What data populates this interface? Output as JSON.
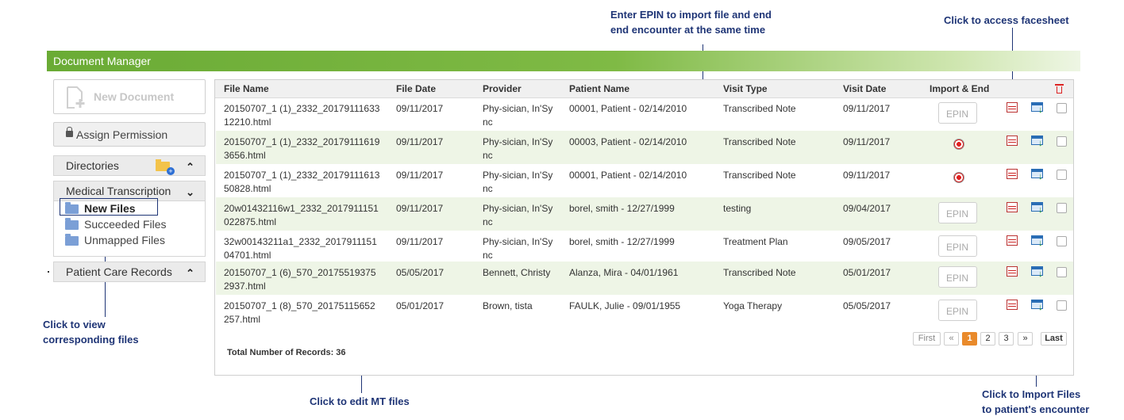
{
  "callouts": {
    "epin": "Enter EPIN to import file and end\nend encounter at the same time",
    "facesheet": "Click to access facesheet",
    "view_files": "Click to view\ncorresponding files",
    "edit_mt": "Click to edit MT files",
    "import_files": "Click to Import Files\nto patient's encounter"
  },
  "header": {
    "title": "Document Manager"
  },
  "sidebar": {
    "new_document": "New Document",
    "assign_permission": "Assign Permission",
    "directories": "Directories",
    "medical_transcription": "Medical Transcription",
    "tree": [
      "New Files",
      "Succeeded Files",
      "Unmapped Files"
    ],
    "patient_care_records": "Patient Care Records"
  },
  "grid": {
    "columns": [
      "File Name",
      "File Date",
      "Provider",
      "Patient Name",
      "Visit Type",
      "Visit Date",
      "Import & End"
    ],
    "rows": [
      {
        "file": "20150707_1 (1)_2332_20179111633\n12210.html",
        "date": "09/11/2017",
        "provider": "Phy-sician, In'Sy\nnc",
        "patient": "00001, Patient - 02/14/2010",
        "visit_type": "Transcribed Note",
        "visit_date": "09/11/2017",
        "action": "epin"
      },
      {
        "file": "20150707_1 (1)_2332_20179111619\n3656.html",
        "date": "09/11/2017",
        "provider": "Phy-sician, In'Sy\nnc",
        "patient": "00003, Patient - 02/14/2010",
        "visit_type": "Transcribed Note",
        "visit_date": "09/11/2017",
        "action": "end"
      },
      {
        "file": "20150707_1 (1)_2332_20179111613\n50828.html",
        "date": "09/11/2017",
        "provider": "Phy-sician, In'Sy\nnc",
        "patient": "00001, Patient - 02/14/2010",
        "visit_type": "Transcribed Note",
        "visit_date": "09/11/2017",
        "action": "end"
      },
      {
        "file": "20w01432116w1_2332_2017911151\n022875.html",
        "date": "09/11/2017",
        "provider": "Phy-sician, In'Sy\nnc",
        "patient": "borel, smith - 12/27/1999",
        "visit_type": "testing",
        "visit_date": "09/04/2017",
        "action": "epin"
      },
      {
        "file": "32w00143211a1_2332_2017911151\n04701.html",
        "date": "09/11/2017",
        "provider": "Phy-sician, In'Sy\nnc",
        "patient": "borel, smith - 12/27/1999",
        "visit_type": "Treatment Plan",
        "visit_date": "09/05/2017",
        "action": "epin"
      },
      {
        "file": "20150707_1 (6)_570_20175519375\n2937.html",
        "date": "05/05/2017",
        "provider": "Bennett, Christy",
        "patient": "Alanza, Mira - 04/01/1961",
        "visit_type": "Transcribed Note",
        "visit_date": "05/01/2017",
        "action": "epin"
      },
      {
        "file": "20150707_1 (8)_570_20175115652\n257.html",
        "date": "05/01/2017",
        "provider": "Brown, tista",
        "patient": "FAULK, Julie - 09/01/1955",
        "visit_type": "Yoga Therapy",
        "visit_date": "05/05/2017",
        "action": "epin"
      }
    ],
    "epin_placeholder": "EPIN",
    "total_records": "Total Number of Records: 36"
  },
  "pager": {
    "first": "First",
    "prev": "«",
    "pages": [
      "1",
      "2",
      "3"
    ],
    "next": "»",
    "last": "Last",
    "current": "1"
  },
  "colors": {
    "accent": "#6aab35",
    "callout": "#1f3576",
    "active_page": "#e98a2b",
    "alt_row": "#eef5e6"
  }
}
